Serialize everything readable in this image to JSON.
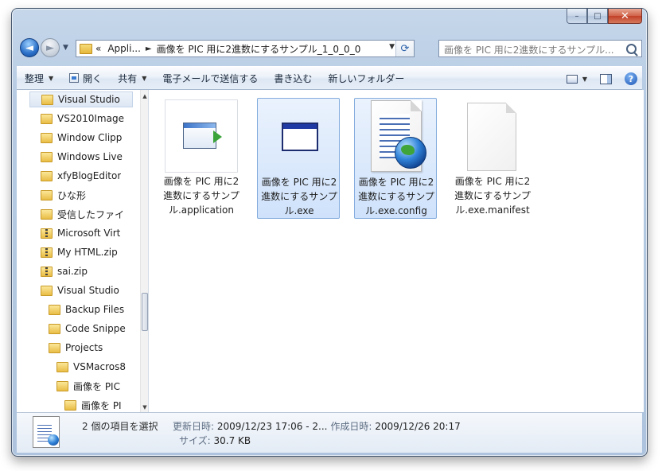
{
  "window": {
    "caption_buttons": {
      "minimize": "–",
      "maximize": "□",
      "close": "✕"
    }
  },
  "address": {
    "overflow": "«",
    "crumb1": "Appli...",
    "crumb2": "画像を PIC 用に2進数にするサンプル_1_0_0_0",
    "search_placeholder": "画像を PIC 用に2進数にするサンプル..."
  },
  "toolbar": {
    "organize": "整理",
    "open": "開く",
    "share": "共有",
    "email": "電子メールで送信する",
    "burn": "書き込む",
    "new_folder": "新しいフォルダー"
  },
  "tree": [
    {
      "label": "Visual Studio",
      "type": "folder",
      "selected": true
    },
    {
      "label": "VS2010Image",
      "type": "folder"
    },
    {
      "label": "Window Clipp",
      "type": "folder"
    },
    {
      "label": "Windows Live",
      "type": "folder"
    },
    {
      "label": "xfyBlogEditor",
      "type": "folder"
    },
    {
      "label": "ひな形",
      "type": "folder"
    },
    {
      "label": "受信したファイ",
      "type": "folder"
    },
    {
      "label": "Microsoft Virt",
      "type": "zip"
    },
    {
      "label": "My HTML.zip",
      "type": "zip"
    },
    {
      "label": "sai.zip",
      "type": "zip"
    },
    {
      "label": "Visual Studio",
      "type": "folder"
    },
    {
      "label": "Backup Files",
      "type": "folder"
    },
    {
      "label": "Code Snippe",
      "type": "folder"
    },
    {
      "label": "Projects",
      "type": "folder"
    },
    {
      "label": "VSMacros8",
      "type": "folder"
    },
    {
      "label": "画像を PIC",
      "type": "folder"
    },
    {
      "label": "画像を PI",
      "type": "folder"
    }
  ],
  "files": [
    {
      "name": "画像を PIC 用に2進数にするサンプル.application",
      "icon": "application-icon",
      "selected": false
    },
    {
      "name": "画像を PIC 用に2進数にするサンプル.exe",
      "icon": "exe-icon",
      "selected": true
    },
    {
      "name": "画像を PIC 用に2進数にするサンプル.exe.config",
      "icon": "config-icon",
      "selected": true
    },
    {
      "name": "画像を PIC 用に2進数にするサンプル.exe.manifest",
      "icon": "manifest-icon",
      "selected": false
    }
  ],
  "details": {
    "count": "2 個の項目を選択",
    "modified_label": "更新日時:",
    "modified_value": "2009/12/23 17:06 - 2...",
    "created_label": "作成日時:",
    "created_value": "2009/12/26 20:17",
    "size_label": "サイズ:",
    "size_value": "30.7 KB"
  }
}
